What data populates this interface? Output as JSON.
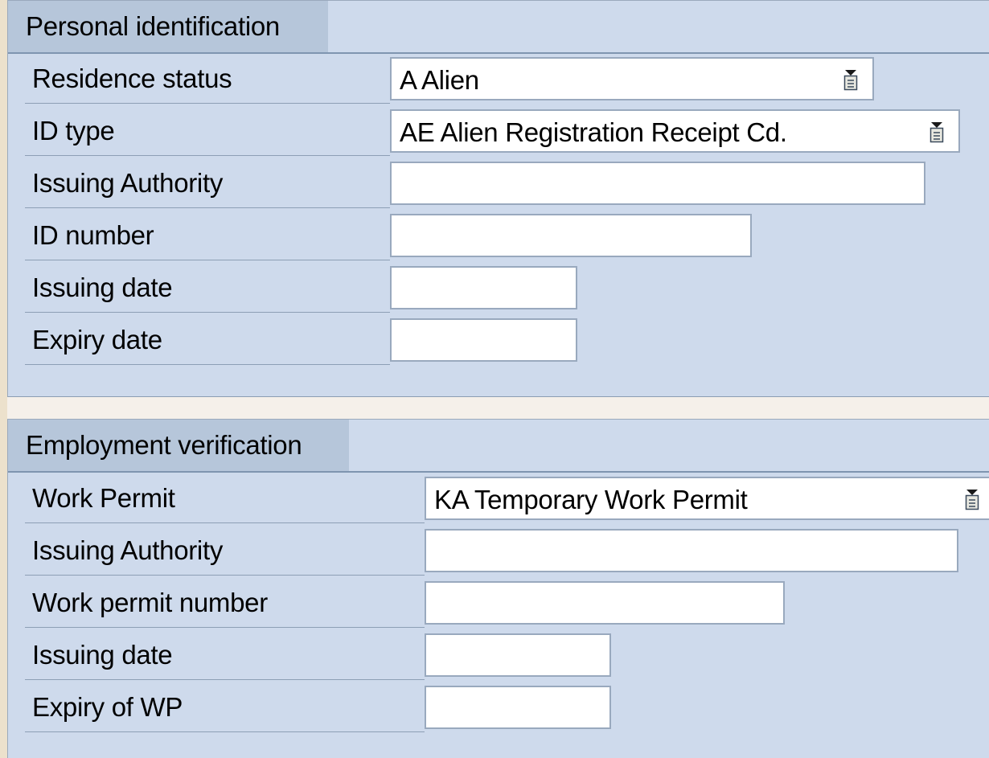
{
  "personal_identification": {
    "title": "Personal identification",
    "residence_status": {
      "label": "Residence status",
      "value": "A Alien",
      "icon": "value-help-icon"
    },
    "id_type": {
      "label": "ID type",
      "value": "AE Alien Registration Receipt Cd.",
      "icon": "value-help-icon"
    },
    "issuing_authority": {
      "label": "Issuing Authority",
      "value": ""
    },
    "id_number": {
      "label": "ID number",
      "value": ""
    },
    "issuing_date": {
      "label": "Issuing date",
      "value": ""
    },
    "expiry_date": {
      "label": "Expiry date",
      "value": ""
    }
  },
  "employment_verification": {
    "title": "Employment verification",
    "work_permit": {
      "label": "Work Permit",
      "value": "KA Temporary Work Permit",
      "icon": "value-help-icon"
    },
    "issuing_authority": {
      "label": "Issuing Authority",
      "value": ""
    },
    "work_permit_number": {
      "label": "Work permit number",
      "value": ""
    },
    "issuing_date": {
      "label": "Issuing date",
      "value": ""
    },
    "expiry_of_wp": {
      "label": "Expiry of WP",
      "value": ""
    }
  },
  "colors": {
    "group_background": "#cedaec",
    "group_title_background": "#b6c6da",
    "field_border": "#99a9be",
    "page_background": "#ece1cc"
  }
}
